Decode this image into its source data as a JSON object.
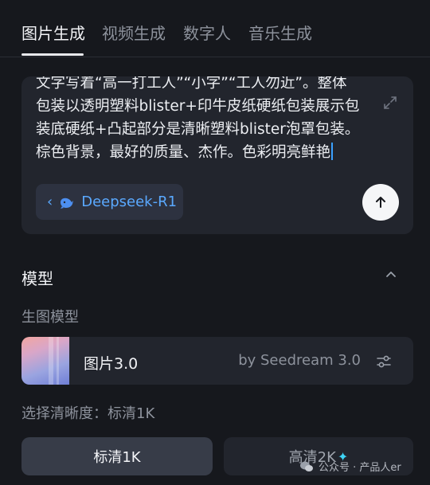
{
  "tabs": [
    {
      "label": "图片生成",
      "active": true
    },
    {
      "label": "视频生成",
      "active": false
    },
    {
      "label": "数字人",
      "active": false
    },
    {
      "label": "音乐生成",
      "active": false
    }
  ],
  "prompt": {
    "lines": [
      "文字写着“高一打工人”“小字”“工人勿近”。整体",
      "包装以透明塑料blister+印牛皮纸硬纸包装展示包",
      "装底硬纸+凸起部分是清晰塑料blister泡罩包装。",
      "棕色背景，最好的质量、杰作。色彩明亮鲜艳"
    ],
    "model_chip": "Deepseek-R1"
  },
  "model_section": {
    "title": "模型",
    "sub_label": "生图模型",
    "model_name": "图片3.0",
    "model_by": "by Seedream 3.0"
  },
  "resolution": {
    "label": "选择清晰度：标清1K",
    "options": [
      {
        "label": "标清1K",
        "selected": true
      },
      {
        "label": "高清2K",
        "selected": false
      }
    ]
  },
  "watermark": "公众号 · 产品人er",
  "colors": {
    "background": "#16181d",
    "card": "#22252d",
    "accent": "#5aa9ff",
    "caret": "#3aa0ff",
    "sparkle": "#3fd4f5"
  }
}
